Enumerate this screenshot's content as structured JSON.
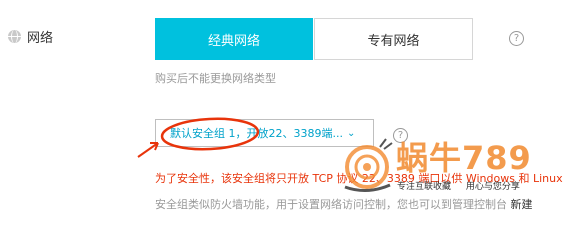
{
  "section": {
    "label": "网络",
    "icon": "globe-icon"
  },
  "network_type": {
    "options": [
      {
        "label": "经典网络",
        "selected": true
      },
      {
        "label": "专有网络",
        "selected": false
      }
    ],
    "help": "?",
    "note": "购买后不能更换网络类型"
  },
  "security_group": {
    "selected_label": "默认安全组 1，开放22、3389端...",
    "chevron_icon": "chevron-down-icon",
    "help": "?",
    "warning": "为了安全性，该安全组将只开放 TCP 协议 22、3389 端口以供 Windows 和 Linux 登录到公",
    "description": "安全组类似防火墙功能，用于设置网络访问控制，您也可以到管理控制台",
    "description_link": "新建"
  },
  "watermark": {
    "title": "蜗牛789",
    "tagline_1": "专注互联收藏",
    "tagline_2": "用心与您分享"
  },
  "colors": {
    "accent": "#00c1de",
    "link": "#00a2ca",
    "warning": "#e8340b",
    "annotation": "#e8340b",
    "watermark": "#f28a2e"
  }
}
